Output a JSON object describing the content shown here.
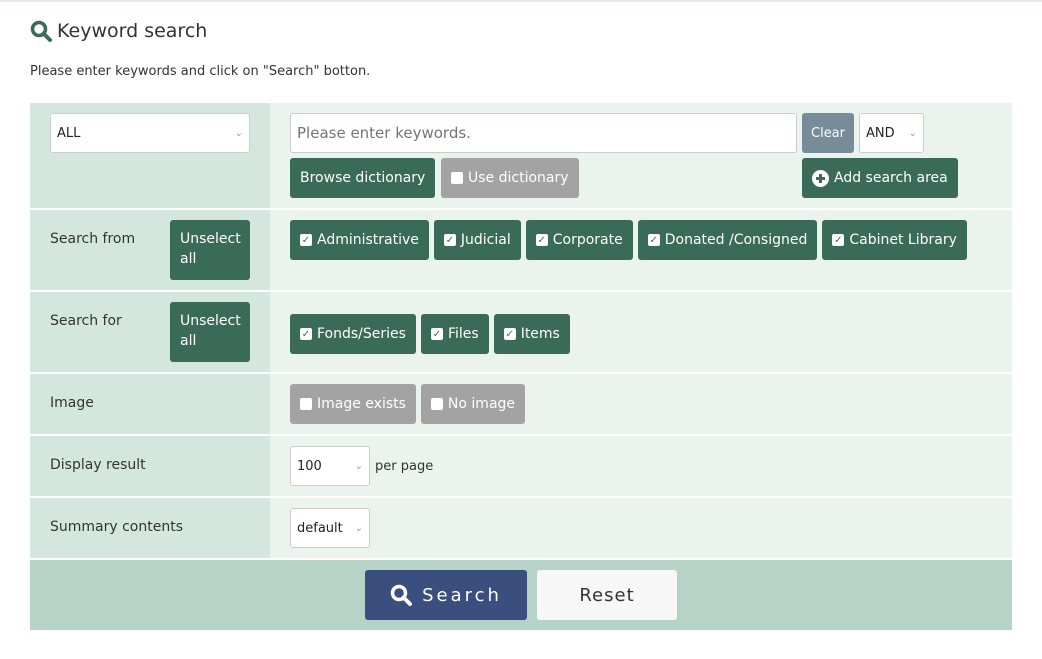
{
  "title": "Keyword search",
  "description": "Please enter keywords and click on \"Search\" botton.",
  "colors": {
    "primary": "#3a6b58",
    "search_button": "#3a4f7e",
    "label_bg": "#d4e7df",
    "value_bg": "#eaf3ee",
    "footer_bg": "#b7d3c8"
  },
  "keyword": {
    "field_select": "ALL",
    "placeholder": "Please enter keywords.",
    "value": "",
    "clear": "Clear",
    "operator": "AND",
    "browse_dictionary": "Browse dictionary",
    "use_dictionary": "Use dictionary",
    "use_dictionary_checked": false,
    "add_search_area": "Add search area"
  },
  "search_from": {
    "label": "Search from",
    "unselect_all": "Unselect all",
    "options": [
      {
        "label": "Administrative",
        "checked": true
      },
      {
        "label": "Judicial",
        "checked": true
      },
      {
        "label": "Corporate",
        "checked": true
      },
      {
        "label": "Donated /Consigned",
        "checked": true
      },
      {
        "label": "Cabinet Library",
        "checked": true
      }
    ]
  },
  "search_for": {
    "label": "Search for",
    "unselect_all": "Unselect all",
    "options": [
      {
        "label": "Fonds/Series",
        "checked": true
      },
      {
        "label": "Files",
        "checked": true
      },
      {
        "label": "Items",
        "checked": true
      }
    ]
  },
  "image": {
    "label": "Image",
    "options": [
      {
        "label": "Image exists",
        "checked": false
      },
      {
        "label": "No image",
        "checked": false
      }
    ]
  },
  "display_result": {
    "label": "Display result",
    "value": "100",
    "suffix": "per page"
  },
  "summary": {
    "label": "Summary contents",
    "value": "default"
  },
  "footer": {
    "search": "Search",
    "reset": "Reset"
  }
}
